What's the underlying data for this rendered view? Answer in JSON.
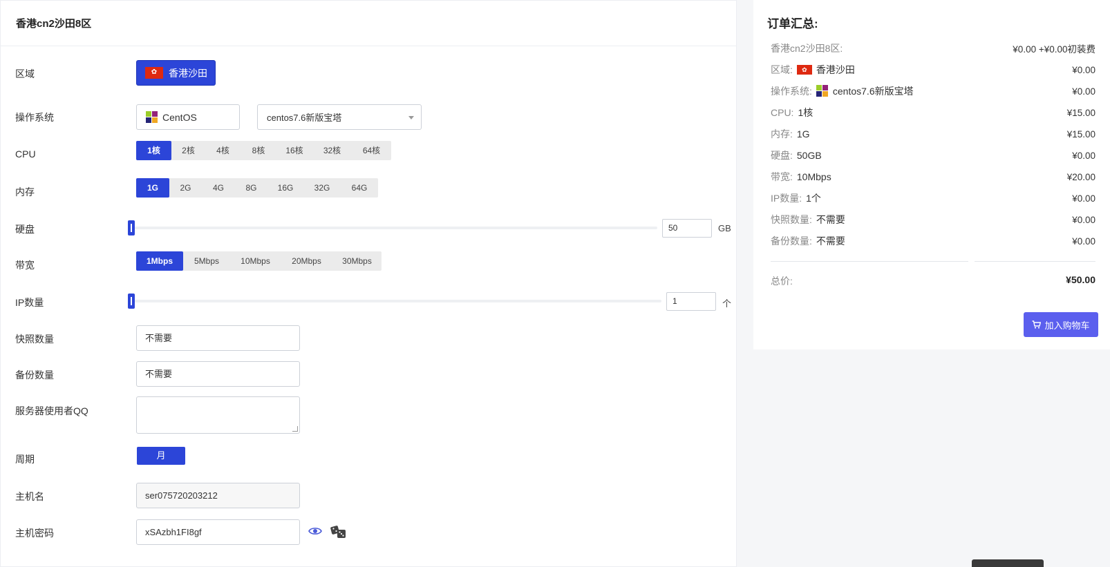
{
  "product": {
    "title": "香港cn2沙田8区"
  },
  "form": {
    "region": {
      "label": "区域",
      "value": "香港沙田"
    },
    "os": {
      "label": "操作系统",
      "family": "CentOS",
      "version": "centos7.6新版宝塔"
    },
    "cpu": {
      "label": "CPU",
      "options": [
        "1核",
        "2核",
        "4核",
        "8核",
        "16核",
        "32核",
        "64核"
      ],
      "selected": "1核"
    },
    "memory": {
      "label": "内存",
      "options": [
        "1G",
        "2G",
        "4G",
        "8G",
        "16G",
        "32G",
        "64G"
      ],
      "selected": "1G"
    },
    "disk": {
      "label": "硬盘",
      "value": "50",
      "unit": "GB",
      "slider_fraction": 0
    },
    "bandwidth": {
      "label": "带宽",
      "options": [
        "1Mbps",
        "5Mbps",
        "10Mbps",
        "20Mbps",
        "30Mbps"
      ],
      "selected": "1Mbps"
    },
    "ip": {
      "label": "IP数量",
      "value": "1",
      "unit": "个",
      "slider_fraction": 0
    },
    "snapshot": {
      "label": "快照数量",
      "value": "不需要"
    },
    "backup": {
      "label": "备份数量",
      "value": "不需要"
    },
    "qq": {
      "label": "服务器使用者QQ",
      "value": ""
    },
    "period": {
      "label": "周期",
      "value": "月"
    },
    "hostname": {
      "label": "主机名",
      "value": "ser075720203212"
    },
    "password": {
      "label": "主机密码",
      "value": "xSAzbh1FI8gf"
    }
  },
  "summary": {
    "title": "订单汇总:",
    "product_key": "香港cn2沙田8区:",
    "product_price": "¥0.00 +¥0.00初装费",
    "rows": [
      {
        "key": "区域:",
        "value": "香港沙田",
        "price": "¥0.00",
        "icon": "hk-flag-icon"
      },
      {
        "key": "操作系统:",
        "value": "centos7.6新版宝塔",
        "price": "¥0.00",
        "icon": "centos-icon"
      },
      {
        "key": "CPU:",
        "value": "1核",
        "price": "¥15.00"
      },
      {
        "key": "内存:",
        "value": "1G",
        "price": "¥15.00"
      },
      {
        "key": "硬盘:",
        "value": "50GB",
        "price": "¥0.00"
      },
      {
        "key": "带宽:",
        "value": "10Mbps",
        "price": "¥20.00"
      },
      {
        "key": "IP数量:",
        "value": "1个",
        "price": "¥0.00"
      },
      {
        "key": "快照数量:",
        "value": "不需要",
        "price": "¥0.00"
      },
      {
        "key": "备份数量:",
        "value": "不需要",
        "price": "¥0.00"
      }
    ],
    "total_label": "总价:",
    "total_value": "¥50.00",
    "cart_button": "加入购物车"
  },
  "colors": {
    "primary": "#2c45d8",
    "cart": "#5b5fee",
    "hk_red": "#de2910"
  }
}
